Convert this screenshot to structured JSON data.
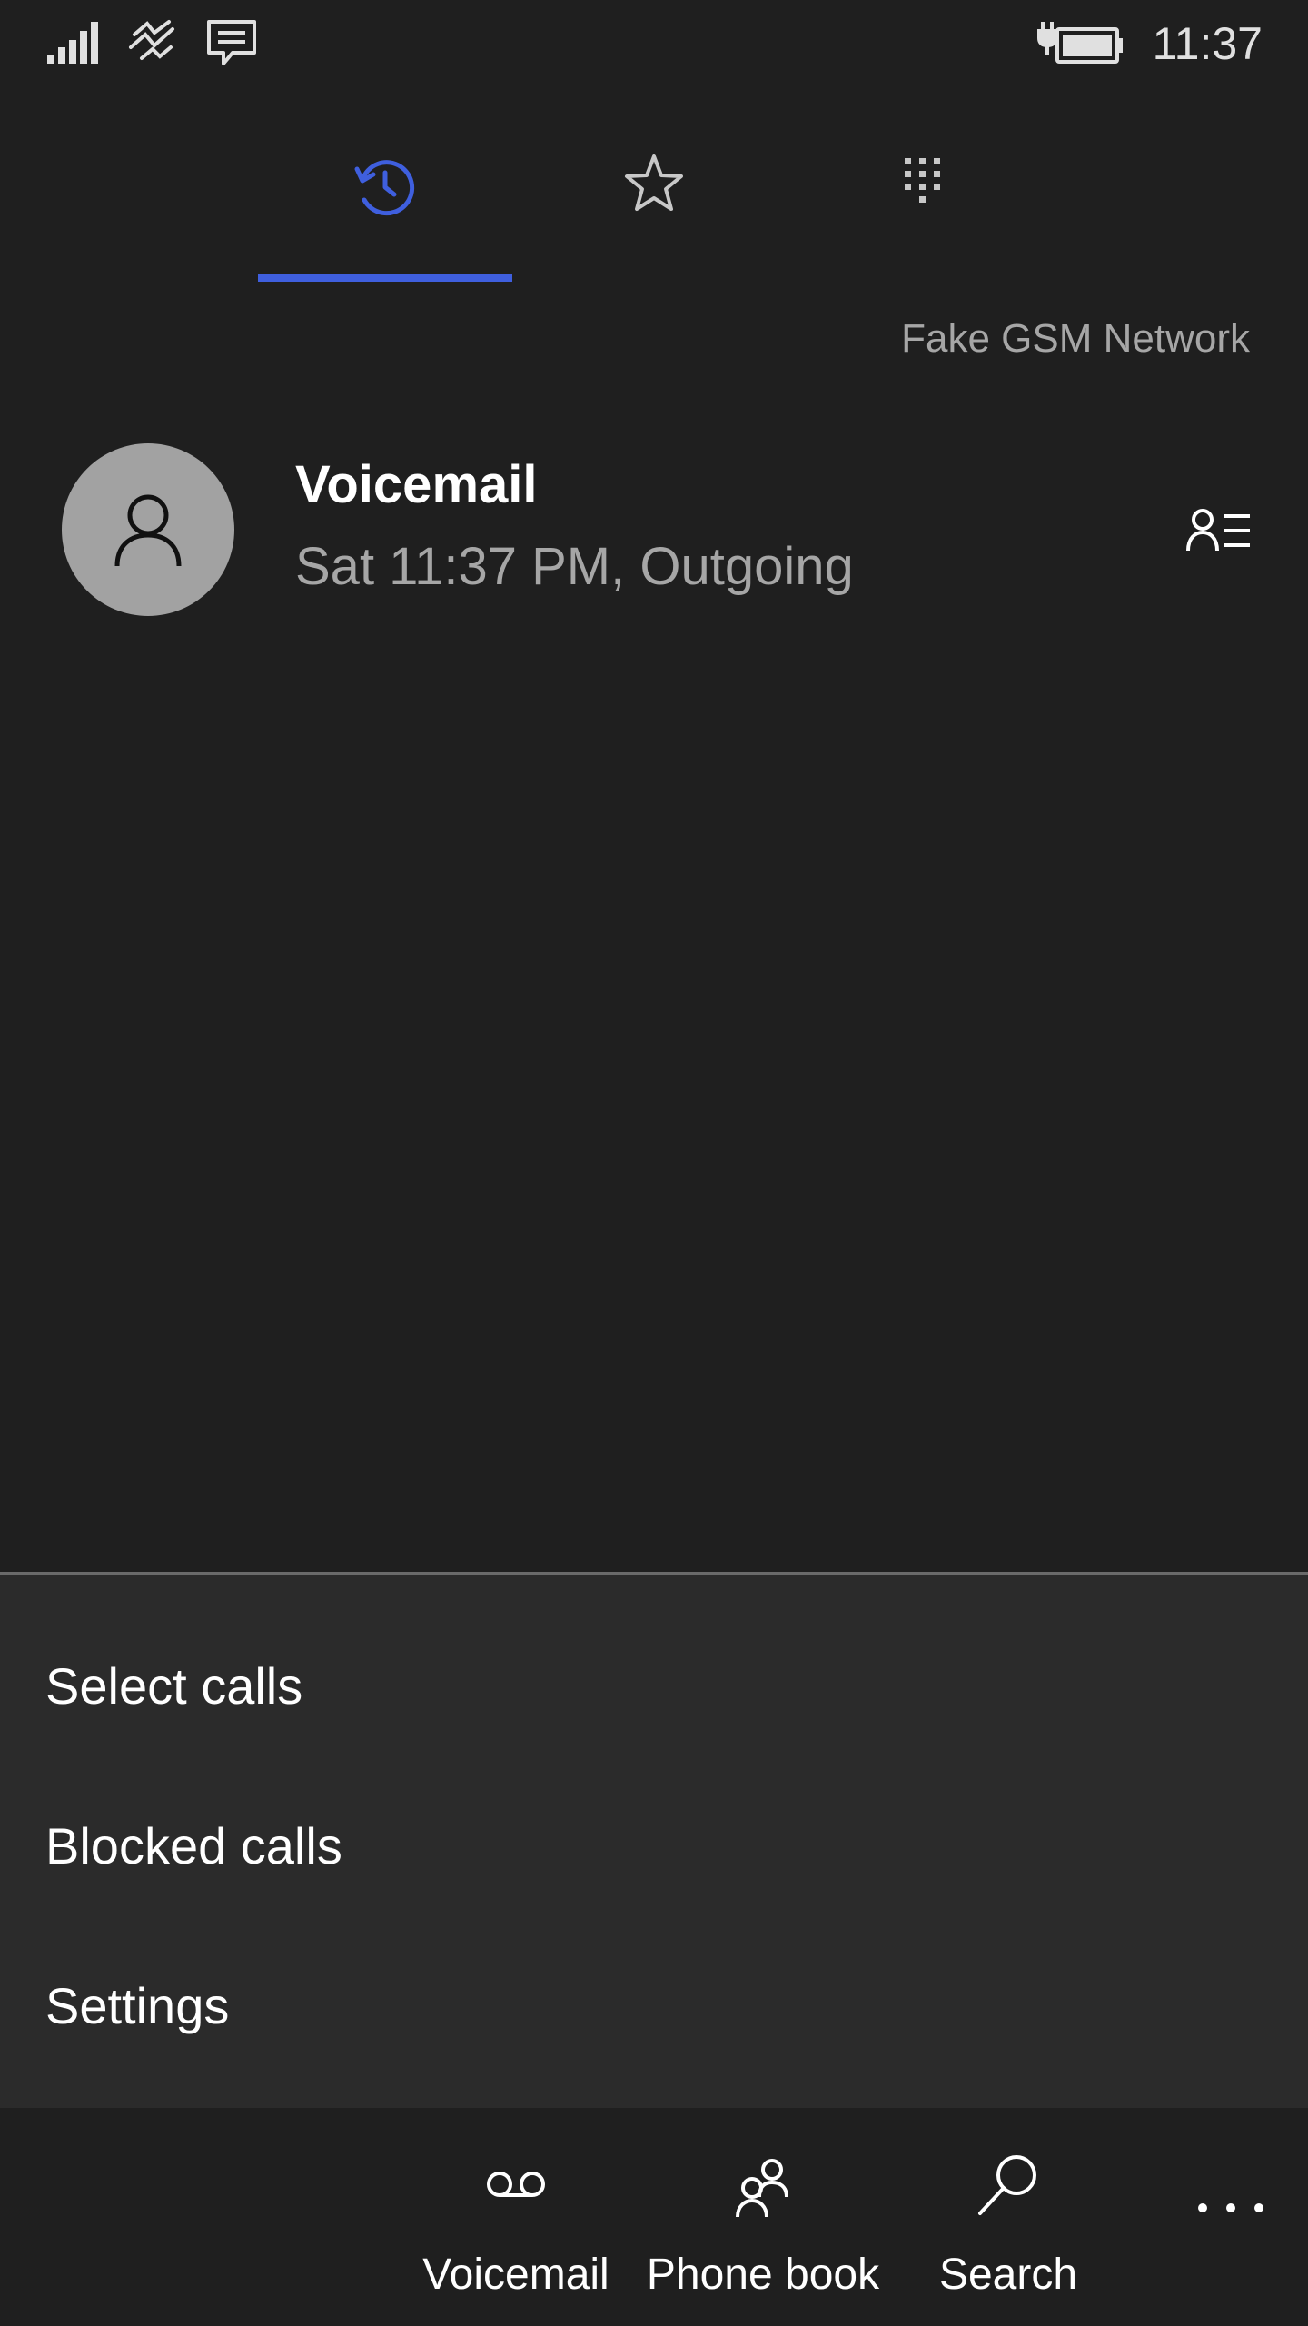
{
  "status_bar": {
    "time": "11:37",
    "icons": [
      "signal-bars-icon",
      "wifi-calling-icon",
      "message-icon",
      "battery-charging-icon"
    ]
  },
  "tabs": [
    {
      "name": "history",
      "icon": "history-icon",
      "selected": true
    },
    {
      "name": "speed-dial",
      "icon": "star-icon",
      "selected": false
    },
    {
      "name": "keypad",
      "icon": "dialpad-icon",
      "selected": false
    }
  ],
  "colors": {
    "accent": "#3f5fde",
    "background": "#1f1f1f",
    "menu_background": "#2b2b2b",
    "secondary_text": "#a6a6a6",
    "avatar": "#a2a2a2"
  },
  "network": {
    "label": "Fake GSM Network"
  },
  "call_history": [
    {
      "name": "Voicemail",
      "detail": "Sat 11:37 PM, Outgoing",
      "avatar_icon": "person-icon",
      "action_icon": "contact-details-icon"
    }
  ],
  "menu": {
    "items": [
      "Select calls",
      "Blocked calls",
      "Settings"
    ]
  },
  "app_bar": {
    "buttons": [
      {
        "label": "Voicemail",
        "icon": "voicemail-icon"
      },
      {
        "label": "Phone book",
        "icon": "people-icon"
      },
      {
        "label": "Search",
        "icon": "search-icon"
      }
    ],
    "more_icon": "more-icon"
  }
}
